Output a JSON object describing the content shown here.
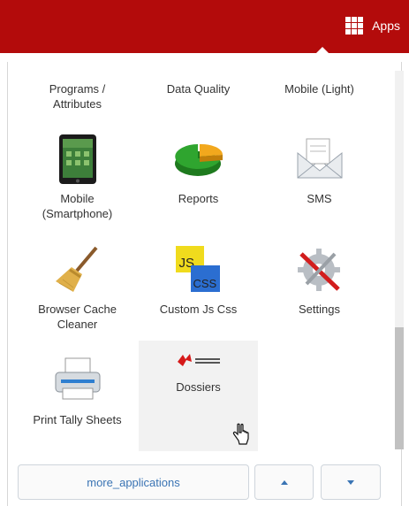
{
  "topbar": {
    "apps_label": "Apps",
    "apps_icon": "apps-grid-icon",
    "color": "#b30b0b"
  },
  "apps_menu": {
    "row1": [
      "Programs / Attributes",
      "Data Quality",
      "Mobile (Light)"
    ],
    "tiles": [
      {
        "label": "Mobile (Smartphone)",
        "icon": "tablet-icon"
      },
      {
        "label": "Reports",
        "icon": "pie-chart-icon"
      },
      {
        "label": "SMS",
        "icon": "envelope-icon"
      },
      {
        "label": "Browser Cache Cleaner",
        "icon": "broom-icon"
      },
      {
        "label": "Custom Js Css",
        "icon": "js-css-icon",
        "js": "JS",
        "css": "CSS"
      },
      {
        "label": "Settings",
        "icon": "gear-tools-icon"
      },
      {
        "label": "Print Tally Sheets",
        "icon": "printer-icon"
      },
      {
        "label": "Dossiers",
        "icon": "msf-logo-icon",
        "hovered": true
      }
    ]
  },
  "footer": {
    "more_label": "more_applications",
    "up_icon": "arrow-up-icon",
    "down_icon": "arrow-down-icon",
    "accent": "#3a74b4"
  }
}
